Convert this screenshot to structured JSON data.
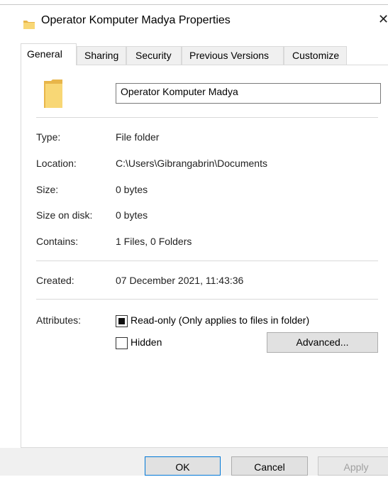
{
  "window": {
    "title": "Operator Komputer Madya Properties",
    "close_glyph": "✕",
    "folder_icon": "folder-icon"
  },
  "tabs": [
    {
      "label": "General",
      "active": true
    },
    {
      "label": "Sharing",
      "active": false
    },
    {
      "label": "Security",
      "active": false
    },
    {
      "label": "Previous Versions",
      "active": false
    },
    {
      "label": "Customize",
      "active": false
    }
  ],
  "general": {
    "name_value": "Operator Komputer Madya",
    "rows": {
      "type": {
        "label": "Type:",
        "value": "File folder"
      },
      "location": {
        "label": "Location:",
        "value": "C:\\Users\\Gibrangabrin\\Documents"
      },
      "size": {
        "label": "Size:",
        "value": "0 bytes"
      },
      "size_on_disk": {
        "label": "Size on disk:",
        "value": "0 bytes"
      },
      "contains": {
        "label": "Contains:",
        "value": "1 Files, 0 Folders"
      },
      "created": {
        "label": "Created:",
        "value": "07 December 2021, 11:43:36"
      }
    },
    "attributes": {
      "label": "Attributes:",
      "readonly": {
        "label": "Read-only (Only applies to files in folder)",
        "state": "indeterminate"
      },
      "hidden": {
        "label": "Hidden",
        "state": "unchecked"
      },
      "advanced_label": "Advanced..."
    }
  },
  "buttons": {
    "ok": "OK",
    "cancel": "Cancel",
    "apply": "Apply"
  },
  "colors": {
    "folder": "#f8d775",
    "folder_dark": "#e8b64a",
    "focus_border": "#0078d7",
    "tab_bg": "#f0f0f0"
  }
}
